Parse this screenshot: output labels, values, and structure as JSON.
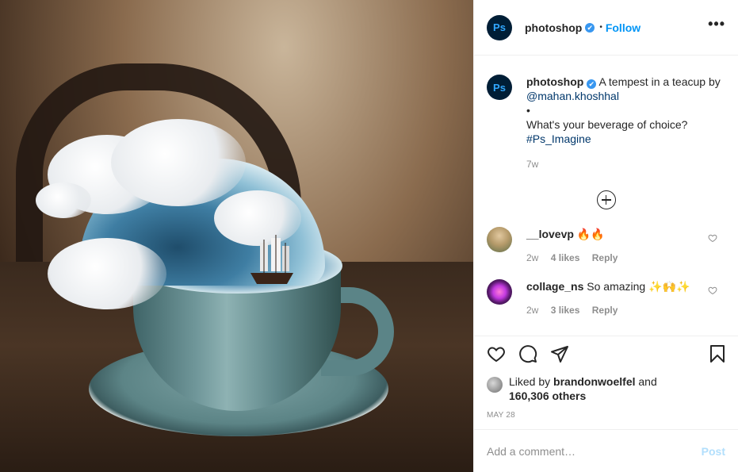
{
  "post": {
    "author": "photoshop",
    "avatar_text": "Ps",
    "verified_mark": "✔",
    "dot": "•",
    "follow_label": "Follow",
    "more_label": "•••"
  },
  "caption": {
    "author": "photoshop",
    "text": "A tempest in a teacup by",
    "mention": "@mahan.khoshhal",
    "bullet": "•",
    "question": "What's your beverage of choice?",
    "hashtag": "#Ps_Imagine",
    "age": "7w"
  },
  "comments": [
    {
      "user": "__lovevp",
      "text": "🔥🔥",
      "age": "2w",
      "likes": "4 likes",
      "reply": "Reply",
      "avatar_color": "#b59a6a"
    },
    {
      "user": "collage_ns",
      "text": "So amazing ✨🙌✨",
      "age": "2w",
      "likes": "3 likes",
      "reply": "Reply",
      "avatar_color": "#c23ae0"
    }
  ],
  "likes": {
    "prefix": "Liked by",
    "user": "brandonwoelfel",
    "and": "and",
    "others": "160,306 others"
  },
  "date": "MAY 28",
  "add_comment": {
    "placeholder": "Add a comment…",
    "post_label": "Post"
  },
  "icons": [
    "heart-icon",
    "comment-icon",
    "share-icon",
    "bookmark-icon",
    "add-circle-icon",
    "small-heart-icon"
  ],
  "colors": {
    "accent": "#0095f6",
    "link": "#00376b",
    "muted": "#8e8e8e",
    "post_disabled": "#b2dffc"
  }
}
